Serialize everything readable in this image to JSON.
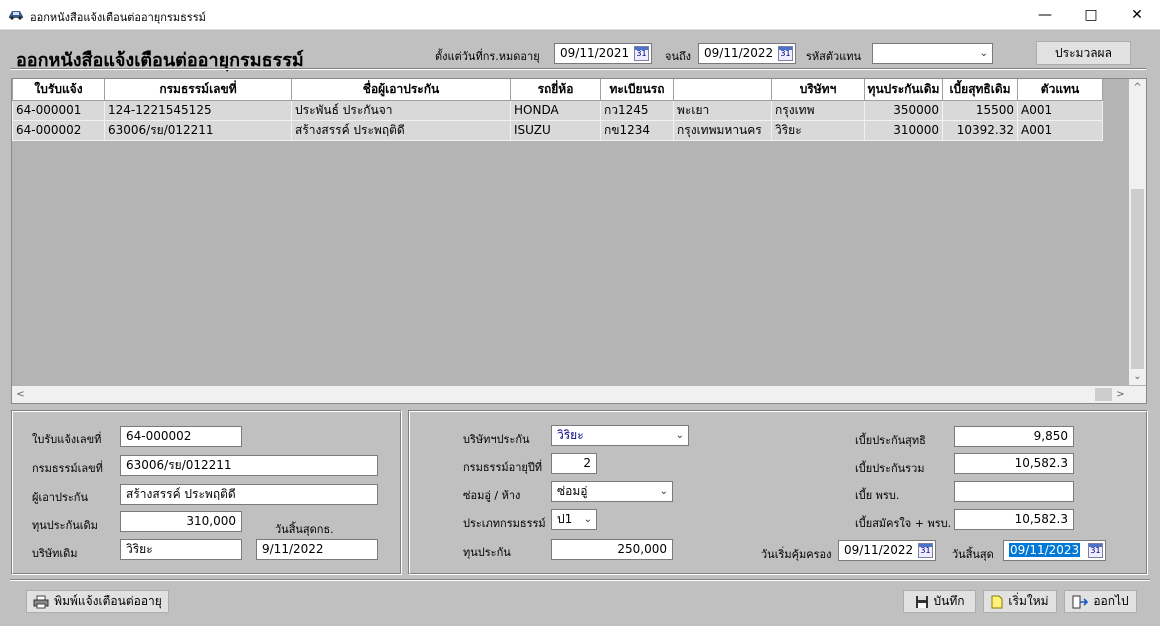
{
  "window": {
    "title": "ออกหนังสือแจ้งเตือนต่ออายุกรมธรรม์"
  },
  "header": {
    "heading": "ออกหนังสือแจ้งเตือนต่ออายุกรมธรรม์",
    "from_label": "ตั้งแต่วันที่กร.หมดอายุ",
    "from_date": "09/11/2021",
    "to_label": "จนถึง",
    "to_date": "09/11/2022",
    "agent_label": "รหัสตัวแทน",
    "agent_value": "",
    "process_label": "ประมวลผล"
  },
  "grid": {
    "columns": [
      "ใบรับแจ้ง",
      "กรมธรรม์เลขที่",
      "ชื่อผู้เอาประกัน",
      "รถยี่ห้อ",
      "ทะเบียนรถ",
      "",
      "บริษัทฯ",
      "ทุนประกันเดิม",
      "เบี้ยสุทธิเดิม",
      "ตัวแทน"
    ],
    "rows": [
      [
        "64-000001",
        "124-1221545125",
        "ประพันธ์ ประกันจา",
        "HONDA",
        "กว1245",
        "พะเยา",
        "กรุงเทพ",
        "350000",
        "15500",
        "A001"
      ],
      [
        "64-000002",
        "63006/รย/012211",
        "สร้างสรรค์  ประพฤติดี",
        "ISUZU",
        "กข1234",
        "กรุงเทพมหานคร",
        "วิริยะ",
        "310000",
        "10392.32",
        "A001"
      ]
    ]
  },
  "left_panel": {
    "receipt_label": "ใบรับแจ้งเลขที่",
    "receipt_value": "64-000002",
    "policy_label": "กรมธรรม์เลขที่",
    "policy_value": "63006/รย/012211",
    "insured_label": "ผู้เอาประกัน",
    "insured_value": "สร้างสรรค์  ประพฤติดี",
    "old_sum_label": "ทุนประกันเดิม",
    "old_sum_value": "310,000",
    "expiry_label": "วันสิ้นสุดกธ.",
    "old_company_label": "บริษัทเดิม",
    "old_company_value": "วิริยะ",
    "expiry_value": "9/11/2022"
  },
  "right_panel": {
    "company_label": "บริษัทฯประกัน",
    "company_value": "วิริยะ",
    "policy_year_label": "กรมธรรม์อายุปีที่",
    "policy_year_value": "2",
    "repair_label": "ซ่อมอู่ / ห้าง",
    "repair_value": "ซ่อมอู่",
    "type_label": "ประเภทกรมธรรม์",
    "type_value": "ป1",
    "sum_label": "ทุนประกัน",
    "sum_value": "250,000",
    "net_premium_label": "เบี้ยประกันสุทธิ",
    "net_premium_value": "9,850",
    "total_premium_label": "เบี้ยประกันรวม",
    "total_premium_value": "10,582.3",
    "compulsory_label": "เบี้ย พรบ.",
    "compulsory_value": "",
    "voluntary_label": "เบี้ยสมัครใจ + พรบ.",
    "voluntary_value": "10,582.3",
    "start_label": "วันเริ่มคุ้มครอง",
    "start_value": "09/11/2022",
    "end_label": "วันสิ้นสุด",
    "end_value": "09/11/2023"
  },
  "footer": {
    "print_label": "พิมพ์แจ้งเตือนต่ออายุ",
    "save_label": "บันทึก",
    "new_label": "เริ่มใหม่",
    "exit_label": "ออกไป"
  },
  "icons": {
    "app": "car-icon",
    "calendar_text": "31",
    "dropdown": "chevron-down-icon",
    "printer": "printer-icon",
    "save": "floppy-icon",
    "new": "new-document-icon",
    "exit": "exit-door-icon"
  }
}
